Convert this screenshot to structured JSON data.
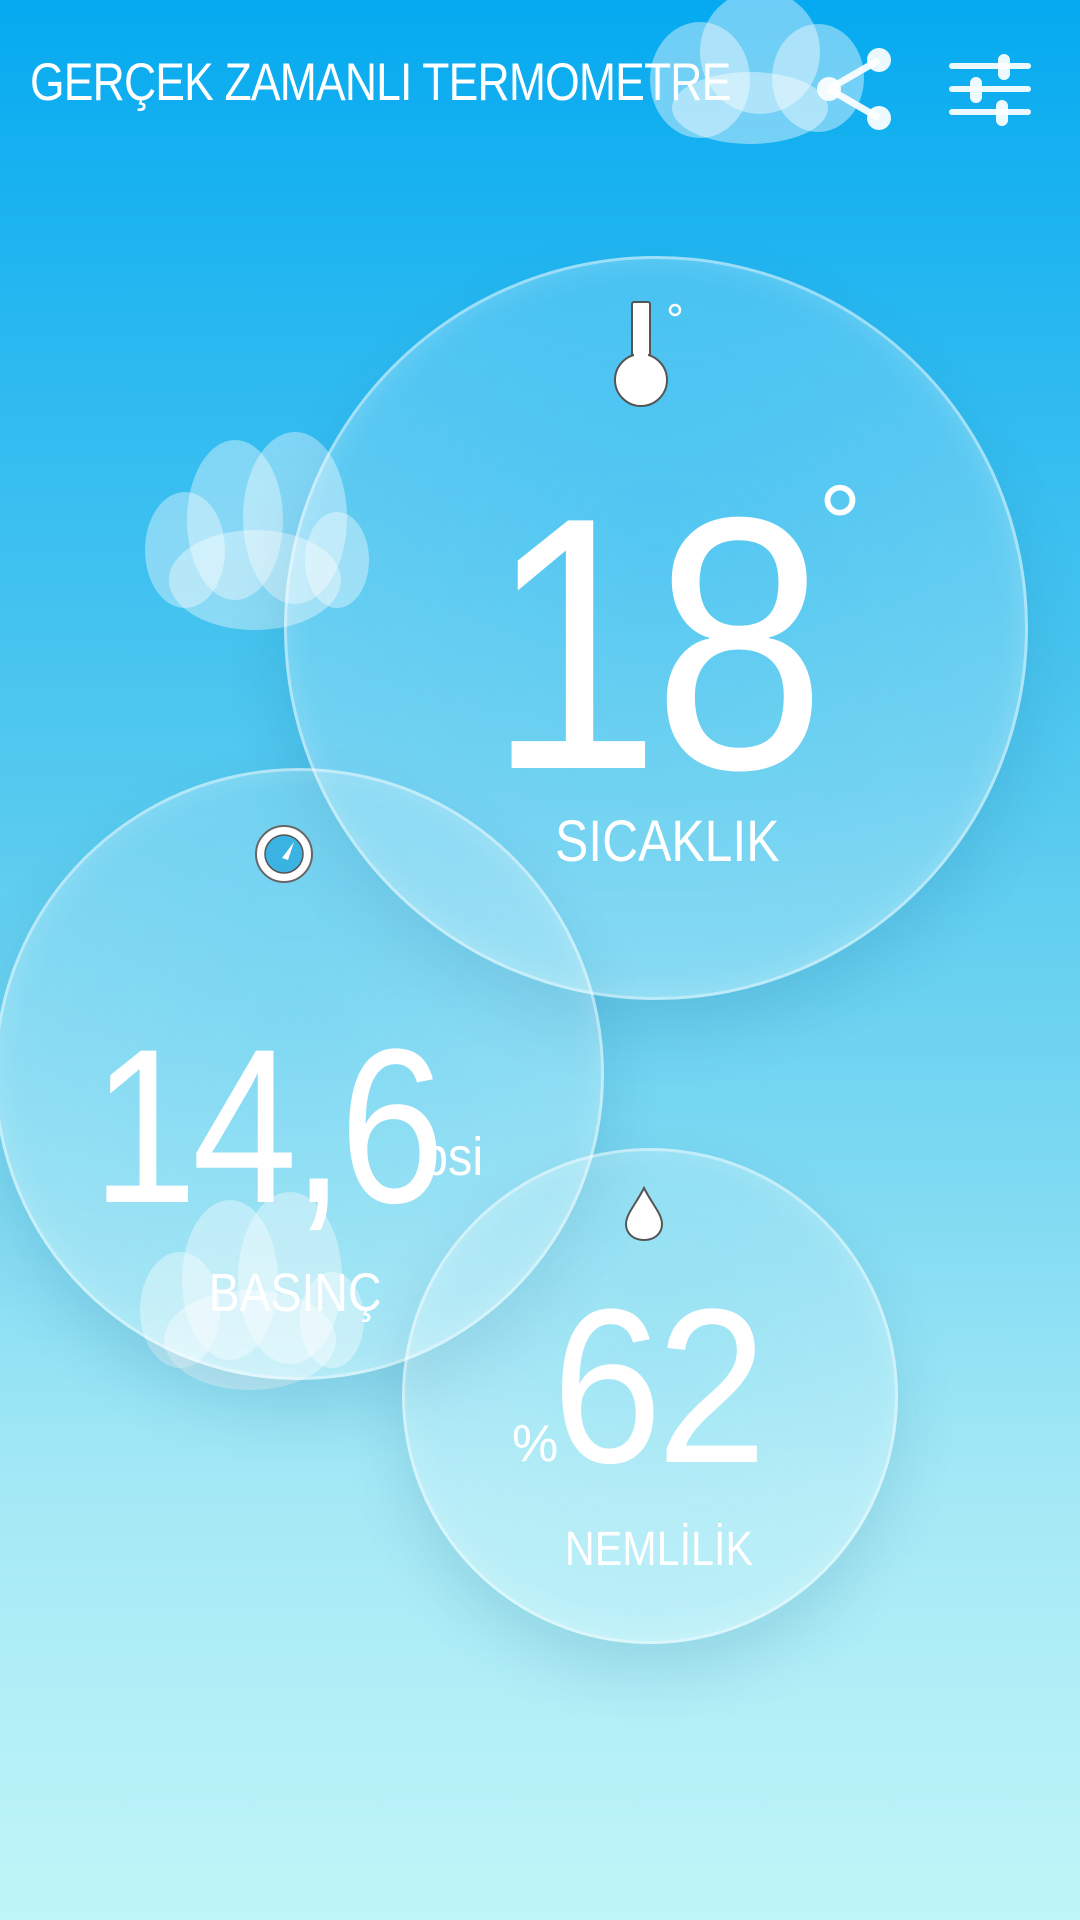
{
  "header": {
    "title": "GERÇEK ZAMANLI TERMOMETRE",
    "share_icon": "share-icon",
    "settings_icon": "tune-sliders-icon"
  },
  "temperature": {
    "icon": "thermometer-icon",
    "value": "18",
    "unit": "°",
    "label": "SICAKLIK"
  },
  "pressure": {
    "icon": "gauge-icon",
    "value": "14,6",
    "unit": "psi",
    "label": "BASINÇ"
  },
  "humidity": {
    "icon": "water-drop-icon",
    "prefix": "%",
    "value": "62",
    "label": "NEMLİLİK"
  },
  "colors": {
    "background_top": "#05aaf0",
    "background_bottom": "#bff6f8",
    "text": "#ffffff"
  }
}
